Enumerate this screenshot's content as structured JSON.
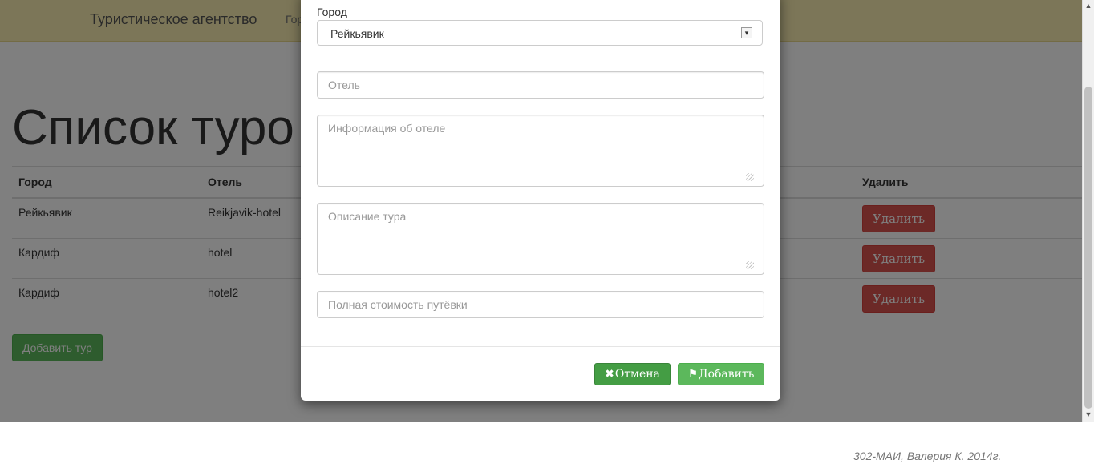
{
  "navbar": {
    "brand": "Туристическое агентство",
    "link": "Гор"
  },
  "page": {
    "title": "Список туро"
  },
  "table": {
    "headers": {
      "city": "Город",
      "hotel": "Отель",
      "delete": "Удалить"
    },
    "rows": [
      {
        "city": "Рейкьявик",
        "hotel": "Reikjavik-hotel",
        "delete_label": "Удалить"
      },
      {
        "city": "Кардиф",
        "hotel": "hotel",
        "delete_label": "Удалить"
      },
      {
        "city": "Кардиф",
        "hotel": "hotel2",
        "delete_label": "Удалить"
      }
    ]
  },
  "add_tour_label": "Добавить тур",
  "modal": {
    "city_label": "Город",
    "city_value": "Рейкьявик",
    "hotel_placeholder": "Отель",
    "hotel_info_placeholder": "Информация об отеле",
    "tour_description_placeholder": "Описание тура",
    "price_placeholder": "Полная стоимость путёвки",
    "cancel_label": "Отмена",
    "submit_label": "Добавить",
    "cancel_icon": "close-icon",
    "submit_icon": "save-icon"
  },
  "footer": {
    "text": "302-МАИ, Валерия К. 2014г."
  },
  "colors": {
    "navbar": "#f8ecb0",
    "danger": "#d9534f",
    "success": "#5cb85c",
    "success_dark": "#449d44"
  }
}
